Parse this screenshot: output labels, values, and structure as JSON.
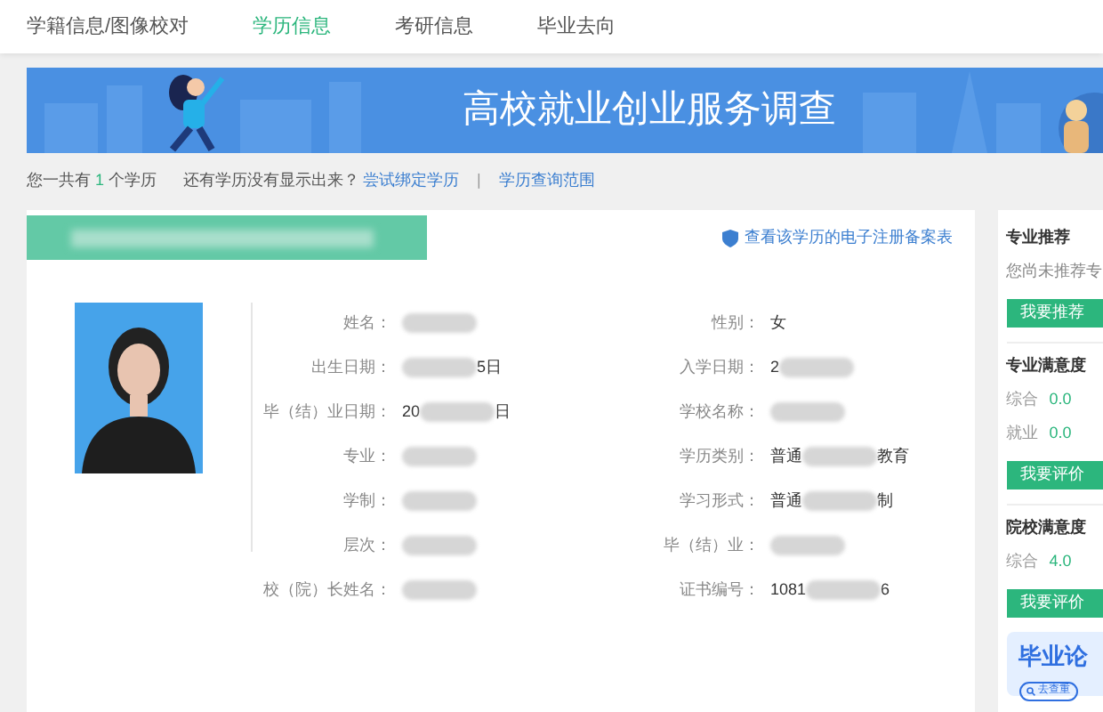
{
  "tabs": [
    {
      "label": "学籍信息/图像校对",
      "selected": false
    },
    {
      "label": "学历信息",
      "selected": true
    },
    {
      "label": "考研信息",
      "selected": false
    },
    {
      "label": "毕业去向",
      "selected": false
    }
  ],
  "banner": {
    "title": "高校就业创业服务调查"
  },
  "summary": {
    "prefix": "您一共有",
    "count": "1",
    "suffix": "个学历",
    "question": "还有学历没有显示出来？",
    "link": "尝试绑定学历",
    "separator": "|",
    "link_2": "学历查询范围"
  },
  "record": {
    "title_blurred": true,
    "registration_link": "查看该学历的电子注册备案表",
    "left_fields": [
      {
        "label": "姓名：",
        "blurred": true
      },
      {
        "label": "出生日期：",
        "blurred": true,
        "after": "5日"
      },
      {
        "label": "毕（结）业日期：",
        "before": "20",
        "blurred": true,
        "after": "日"
      },
      {
        "label": "专业：",
        "blurred": true
      },
      {
        "label": "学制：",
        "blurred": true
      },
      {
        "label": "层次：",
        "blurred": true
      },
      {
        "label": "校（院）长姓名：",
        "blurred": true
      }
    ],
    "right_fields": [
      {
        "label": "性别：",
        "before": "女"
      },
      {
        "label": "入学日期：",
        "before": "2",
        "blurred": true
      },
      {
        "label": "学校名称：",
        "blurred": true
      },
      {
        "label": "学历类别：",
        "before": "普通",
        "blurred": true,
        "after": "教育"
      },
      {
        "label": "学习形式：",
        "before": "普通",
        "blurred": true,
        "after": "制"
      },
      {
        "label": "毕（结）业：",
        "blurred": true
      },
      {
        "label": "证书编号：",
        "before": "1081",
        "blurred": true,
        "after": "6"
      }
    ]
  },
  "sidebar": {
    "sections": [
      {
        "title": "专业推荐",
        "lines": [
          {
            "kind": "note",
            "text": "您尚未推荐专"
          }
        ],
        "button": "我要推荐"
      },
      {
        "title": "专业满意度",
        "lines": [
          {
            "kind": "score",
            "label": "综合",
            "value": "0.0"
          },
          {
            "kind": "score",
            "label": "就业",
            "value": "0.0"
          }
        ],
        "button": "我要评价"
      },
      {
        "title": "院校满意度",
        "lines": [
          {
            "kind": "score",
            "label": "综合",
            "value": "4.0"
          }
        ],
        "button": "我要评价"
      }
    ],
    "promo": {
      "title": "毕业论",
      "button": "去查重"
    }
  }
}
